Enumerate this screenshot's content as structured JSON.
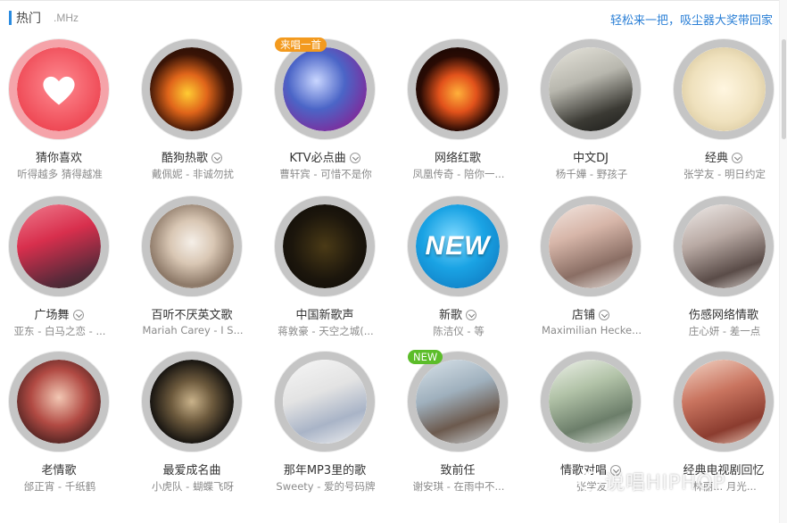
{
  "header": {
    "title": "热门",
    "subtitle": ".MHz",
    "link": "轻松来一把，吸尘器大奖带回家"
  },
  "colors": {
    "accent": "#2a8be0",
    "link": "#2a7fd6"
  },
  "items": [
    {
      "label": "猜你喜欢",
      "sub": "听得越多 猜得越准",
      "dropdown": false,
      "icon": "heart-icon"
    },
    {
      "label": "酷狗热歌",
      "sub": "戴佩妮 - 非诚勿扰",
      "dropdown": true
    },
    {
      "label": "KTV必点曲",
      "sub": "曹轩宾 - 可惜不是你",
      "dropdown": true,
      "badge": "来唱一首"
    },
    {
      "label": "网络红歌",
      "sub": "凤凰传奇 - 陪你一...",
      "dropdown": false
    },
    {
      "label": "中文DJ",
      "sub": "杨千嬅 - 野孩子",
      "dropdown": false
    },
    {
      "label": "经典",
      "sub": "张学友 - 明日约定",
      "dropdown": true
    },
    {
      "label": "广场舞",
      "sub": "亚东 - 白马之恋 - ...",
      "dropdown": true
    },
    {
      "label": "百听不厌英文歌",
      "sub": "Mariah Carey - I S...",
      "dropdown": false
    },
    {
      "label": "中国新歌声",
      "sub": "蒋敦豪 - 天空之城(...",
      "dropdown": false
    },
    {
      "label": "新歌",
      "sub": "陈洁仪 - 等",
      "dropdown": true,
      "art_text": "NEW"
    },
    {
      "label": "店铺",
      "sub": "Maximilian Hecke...",
      "dropdown": true
    },
    {
      "label": "伤感网络情歌",
      "sub": "庄心妍 - 差一点",
      "dropdown": false
    },
    {
      "label": "老情歌",
      "sub": "邰正宵 - 千纸鹤",
      "dropdown": false
    },
    {
      "label": "最爱成名曲",
      "sub": "小虎队 - 蝴蝶飞呀",
      "dropdown": false
    },
    {
      "label": "那年MP3里的歌",
      "sub": "Sweety - 爱的号码牌",
      "dropdown": false
    },
    {
      "label": "致前任",
      "sub": "谢安琪 - 在雨中不...",
      "dropdown": false,
      "badge": "NEW"
    },
    {
      "label": "情歌对唱",
      "sub": "张学友",
      "dropdown": true
    },
    {
      "label": "经典电视剧回忆",
      "sub": "林丽... 月光...",
      "dropdown": false
    }
  ],
  "watermark": "说唱HIPHOP"
}
